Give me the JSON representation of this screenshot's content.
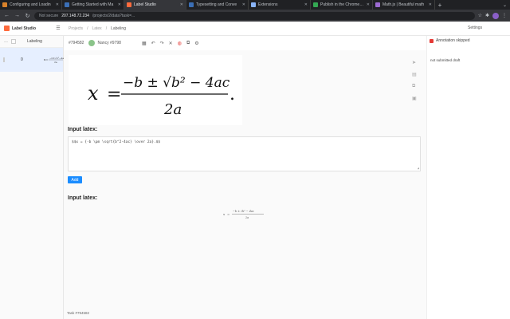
{
  "browser": {
    "tabs": [
      {
        "title": "Configuring and Loadin",
        "color": "#d9822b",
        "active": false
      },
      {
        "title": "Getting Started with Ma",
        "color": "#3b6fb6",
        "active": false
      },
      {
        "title": "Label Studio",
        "color": "#ff6b3d",
        "active": true
      },
      {
        "title": "Typesetting and Conve",
        "color": "#3b6fb6",
        "active": false
      },
      {
        "title": "Extensions",
        "color": "#8ab4f8",
        "active": false
      },
      {
        "title": "Publish in the Chrome W",
        "color": "#34a853",
        "active": false
      },
      {
        "title": "Math.js | Beautiful math",
        "color": "#9c6bd1",
        "active": false
      }
    ],
    "url_security": "Not secure",
    "url_host": "207.148.72.234",
    "url_path": "/projects/2/data?task=..."
  },
  "app": {
    "brand": "Label Studio",
    "breadcrumbs": [
      "Projects",
      "/",
      "Latex",
      "/",
      "Labeling"
    ],
    "settings_label": "Settings"
  },
  "left_panel": {
    "toolbar_label": "Labeling",
    "task_number": "0"
  },
  "main_top": {
    "task_label": "#794582",
    "user_name": "Nancy #9798"
  },
  "formula": {
    "lhs": "x",
    "equals": "=",
    "numerator": "−b ± √b² − 4ac",
    "denominator": "2a",
    "period": "."
  },
  "input1": {
    "label": "Input latex:",
    "value": "$$x = {-b \\pm \\sqrt{b^2-4ac} \\over 2a}.$$"
  },
  "add_button": "Add",
  "input2": {
    "label": "Input latex:"
  },
  "task_id": "Task #794582",
  "right_panel": {
    "skip_status": "Annotation skipped",
    "draft_status": "not submitted draft"
  }
}
